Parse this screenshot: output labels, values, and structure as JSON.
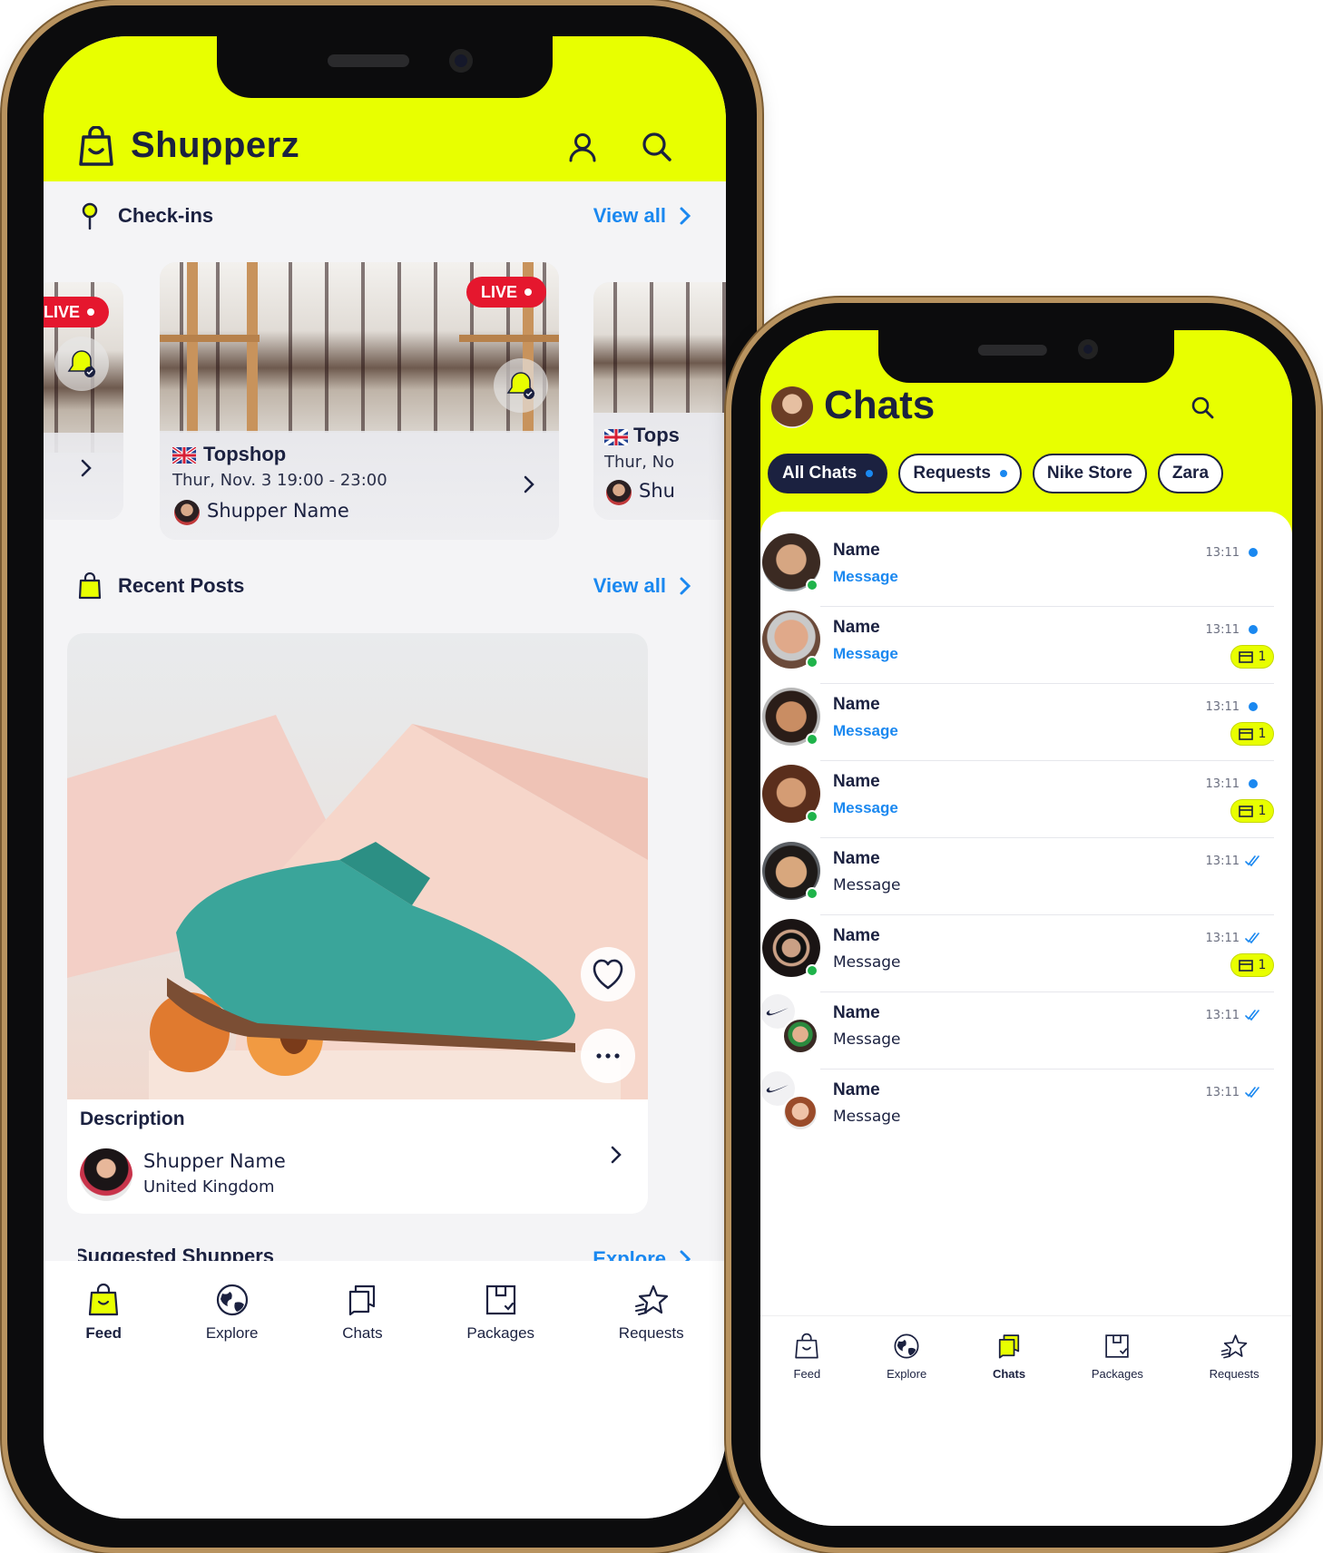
{
  "feed": {
    "app_name": "Shupperz",
    "checkins": {
      "title": "Check-ins",
      "view_all": "View all",
      "cards": [
        {
          "live": "LIVE",
          "store": "Topshop",
          "time": "Thur, Nov. 3 19:00 - 23:00",
          "user": "Shupper Name"
        }
      ],
      "partial_left": {
        "live": "LIVE"
      },
      "partial_right": {
        "store": "Tops",
        "time": "Thur, No",
        "user": "Shu"
      }
    },
    "recent_posts": {
      "title": "Recent Posts",
      "view_all": "View all",
      "post": {
        "description": "Description",
        "user": "Shupper Name",
        "location": "United Kingdom"
      }
    },
    "suggested": {
      "title": "Suggested Shuppers",
      "action": "Explore"
    },
    "tabs": [
      {
        "label": "Feed",
        "icon": "shopping-bag-icon",
        "active": true
      },
      {
        "label": "Explore",
        "icon": "globe-icon",
        "active": false
      },
      {
        "label": "Chats",
        "icon": "chat-bubbles-icon",
        "active": false
      },
      {
        "label": "Packages",
        "icon": "package-icon",
        "active": false
      },
      {
        "label": "Requests",
        "icon": "star-request-icon",
        "active": false
      }
    ]
  },
  "chats": {
    "title": "Chats",
    "filters": [
      {
        "label": "All Chats",
        "active": true,
        "dot": true
      },
      {
        "label": "Requests",
        "active": false,
        "dot": true
      },
      {
        "label": "Nike Store",
        "active": false,
        "dot": false
      },
      {
        "label": "Zara",
        "active": false,
        "dot": false
      }
    ],
    "items": [
      {
        "name": "Name",
        "message": "Message",
        "time": "13:11",
        "unread": true,
        "badge": "",
        "online": true
      },
      {
        "name": "Name",
        "message": "Message",
        "time": "13:11",
        "unread": true,
        "badge": "1",
        "online": true
      },
      {
        "name": "Name",
        "message": "Message",
        "time": "13:11",
        "unread": true,
        "badge": "1",
        "online": true
      },
      {
        "name": "Name",
        "message": "Message",
        "time": "13:11",
        "unread": true,
        "badge": "1",
        "online": true
      },
      {
        "name": "Name",
        "message": "Message",
        "time": "13:11",
        "unread": false,
        "badge": "",
        "online": true
      },
      {
        "name": "Name",
        "message": "Message",
        "time": "13:11",
        "unread": false,
        "badge": "1",
        "online": true
      },
      {
        "name": "Name",
        "message": "Message",
        "time": "13:11",
        "unread": false,
        "badge": "",
        "online": false
      },
      {
        "name": "Name",
        "message": "Message",
        "time": "13:11",
        "unread": false,
        "badge": "",
        "online": false
      }
    ],
    "tabs": [
      {
        "label": "Feed",
        "icon": "shopping-bag-icon",
        "active": false
      },
      {
        "label": "Explore",
        "icon": "globe-icon",
        "active": false
      },
      {
        "label": "Chats",
        "icon": "chat-bubbles-icon",
        "active": true
      },
      {
        "label": "Packages",
        "icon": "package-icon",
        "active": false
      },
      {
        "label": "Requests",
        "icon": "star-request-icon",
        "active": false
      }
    ]
  },
  "colors": {
    "brand_yellow": "#e8ff00",
    "navy": "#1b2140",
    "link_blue": "#1a88f0",
    "live_red": "#e5172e",
    "online_green": "#1fb34a"
  }
}
